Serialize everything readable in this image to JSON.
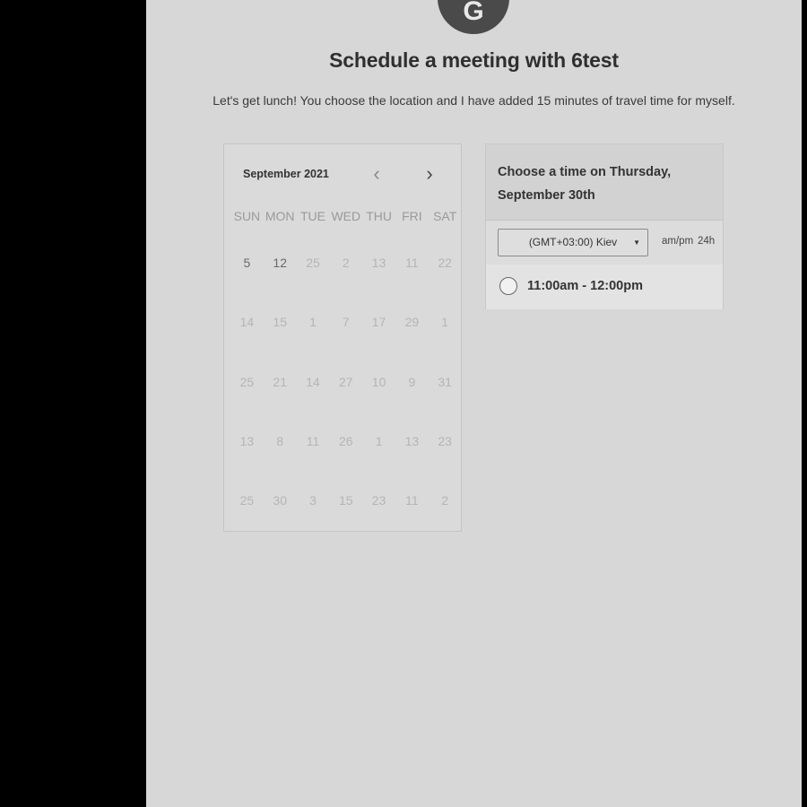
{
  "header": {
    "avatar_initial": "G",
    "title": "Schedule a meeting with 6test",
    "subtitle": "Let's get lunch! You choose the location and I have added 15 minutes of travel time for myself."
  },
  "calendar": {
    "month_label": "September 2021",
    "prev_icon": "‹",
    "next_icon": "›",
    "weekdays": [
      "SUN",
      "MON",
      "TUE",
      "WED",
      "THU",
      "FRI",
      "SAT"
    ],
    "weeks": [
      [
        "5",
        "12",
        "25",
        "2",
        "13",
        "11",
        "22"
      ],
      [
        "14",
        "15",
        "1",
        "7",
        "17",
        "29",
        "1"
      ],
      [
        "25",
        "21",
        "14",
        "27",
        "10",
        "9",
        "31"
      ],
      [
        "13",
        "8",
        "11",
        "26",
        "1",
        "13",
        "23"
      ],
      [
        "25",
        "30",
        "3",
        "15",
        "23",
        "11",
        "2"
      ]
    ]
  },
  "times": {
    "heading_line1": "Choose a time on Thursday,",
    "heading_line2": "September 30th",
    "timezone": "(GMT+03:00) Kiev",
    "format_ampm": "am/pm",
    "format_24": "24h",
    "slot": "11:00am - 12:00pm"
  }
}
